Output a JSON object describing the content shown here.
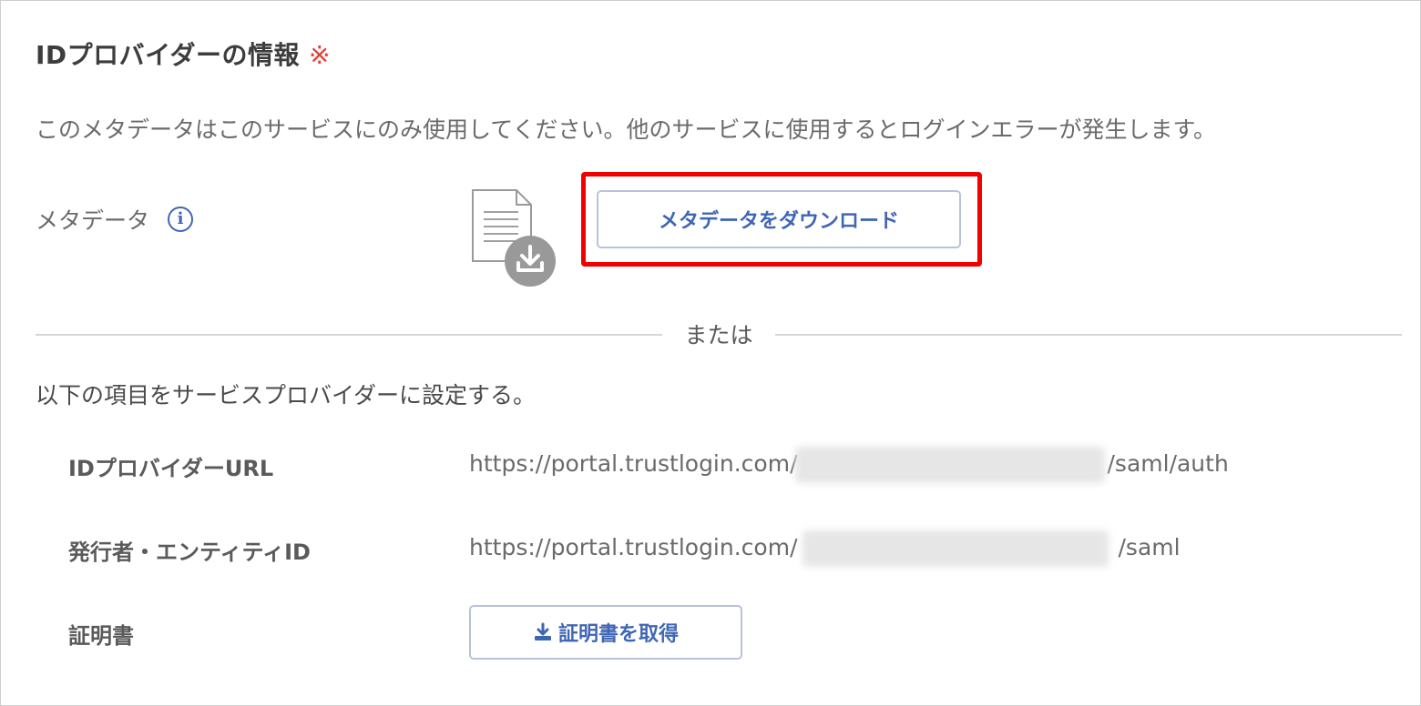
{
  "section": {
    "title": "IDプロバイダーの情報",
    "required_mark": "※",
    "notice": "このメタデータはこのサービスにのみ使用してください。他のサービスに使用するとログインエラーが発生します。"
  },
  "metadata": {
    "label": "メタデータ",
    "info_glyph": "i",
    "download_button": "メタデータをダウンロード"
  },
  "divider": {
    "text": "または"
  },
  "instruction": "以下の項目をサービスプロバイダーに設定する。",
  "rows": [
    {
      "label": "IDプロバイダーURL",
      "value_prefix": "https://portal.trustlogin.com/",
      "value_suffix": "/saml/auth"
    },
    {
      "label": "発行者・エンティティID",
      "value_prefix": "https://portal.trustlogin.com/",
      "value_suffix": "/saml"
    }
  ],
  "certificate": {
    "label": "証明書",
    "button": "証明書を取得"
  },
  "colors": {
    "accent": "#3f66b5",
    "highlight": "#f20000",
    "required": "#e2403a"
  }
}
